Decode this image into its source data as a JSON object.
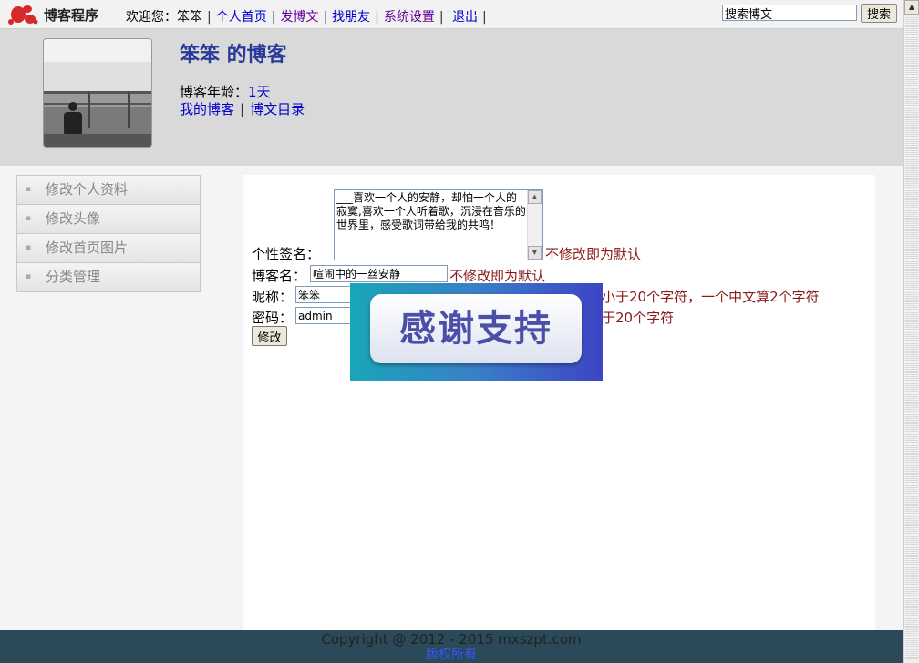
{
  "topbar": {
    "brand": "博客程序",
    "welcome": "欢迎您：笨笨",
    "nav": [
      "个人首页",
      "发博文",
      "找朋友",
      "系统设置",
      "退出"
    ],
    "search_value": "搜索博文",
    "search_button": "搜索"
  },
  "header": {
    "title": "笨笨 的博客",
    "age_label": "博客年龄：",
    "age_value": "1天",
    "links": [
      "我的博客",
      "博文目录"
    ]
  },
  "sidebar": {
    "items": [
      "修改个人资料",
      "修改头像",
      "修改首页图片",
      "分类管理"
    ]
  },
  "form": {
    "signature_label": "个性签名：",
    "signature_value": "___喜欢一个人的安静，却怕一个人的寂寞,喜欢一个人听着歌，沉浸在音乐的世界里，感受歌词带给我的共鸣！",
    "signature_hint": "不修改即为默认",
    "blogname_label": "博客名：",
    "blogname_value": "喧闹中的一丝安静",
    "blogname_hint": "不修改即为默认",
    "nickname_label": "昵称：",
    "nickname_value": "笨笨",
    "nickname_hint": "小于20个字符，一个中文算2个字符",
    "password_label": "密码：",
    "password_value": "admin",
    "password_hint": "于20个字符",
    "submit": "修改"
  },
  "overlay": {
    "text": "感谢支持"
  },
  "footer": {
    "copyright": "Copyright @ 2012 - 2015 mxszpt.com",
    "rights": "版权所有"
  }
}
